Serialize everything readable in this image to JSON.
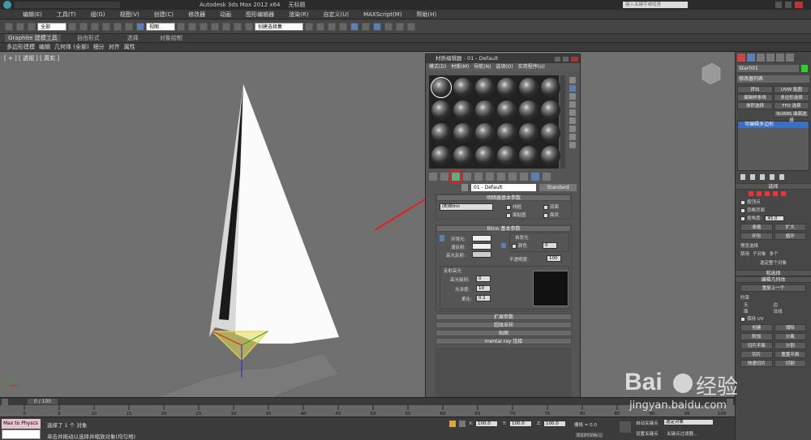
{
  "title_bar": {
    "app_title": "Autodesk 3ds Max  2012 x64",
    "file_name": "无标题",
    "search_placeholder": "键入关键字或短语"
  },
  "menu": [
    "编辑(E)",
    "工具(T)",
    "组(G)",
    "视图(V)",
    "创建(C)",
    "修改器",
    "动画",
    "图形编辑器",
    "渲染(R)",
    "自定义(U)",
    "MAXScript(M)",
    "帮助(H)"
  ],
  "toolbar": {
    "selection_filter": "全部",
    "ref_coord": "视图",
    "named_selection": "创建选择集"
  },
  "ribbon": {
    "tabs": [
      "Graphite 建模工具",
      "自由形式",
      "选择",
      "对象绘制"
    ],
    "sub_items": [
      "多边形建模",
      "编辑",
      "几何体 (全部)",
      "细分",
      "对齐",
      "属性"
    ]
  },
  "viewport": {
    "label": "[ + ] [ 透视 ] [ 真实 ]"
  },
  "material_editor": {
    "title": "材质编辑器 - 01 - Default",
    "menu": [
      "模式(D)",
      "材质(M)",
      "导航(N)",
      "选项(O)",
      "实用程序(U)"
    ],
    "material_name": "01 - Default",
    "material_type": "Standard",
    "shader_rollout": {
      "title": "明暗器基本参数",
      "shader": "(B)Blinn",
      "options": [
        "线框",
        "双面",
        "面贴图",
        "面状"
      ]
    },
    "blinn_rollout": {
      "title": "Blinn 基本参数",
      "self_illum_title": "自发光",
      "color_label": "颜色",
      "self_illum_value": "0",
      "ambient": "环境光:",
      "diffuse": "漫反射:",
      "specular": "高光反射:",
      "opacity_label": "不透明度:",
      "opacity_value": "100",
      "specular_highlights_title": "反射高光",
      "spec_level_label": "高光级别:",
      "spec_level": "0",
      "glossiness_label": "光泽度:",
      "glossiness": "10",
      "soften_label": "柔化:",
      "soften": "0.1"
    },
    "collapsed_rollouts": [
      "扩展参数",
      "超级采样",
      "贴图",
      "mental ray 连接"
    ]
  },
  "command_panel": {
    "object_name": "Star001",
    "modifier_list": "修改器列表",
    "buttons": [
      "挤出",
      "UVW 贴图",
      "编辑样条线",
      "多边形选择",
      "体积选择",
      "FFD 选择",
      "NURBS 曲面选择"
    ],
    "stack_item": "可编辑多边形",
    "selection_title": "选择",
    "by_vertex": "按顶点",
    "ignore_backfacing": "忽略背面",
    "by_angle": "按角度:",
    "angle_value": "45.0",
    "shrink": "收缩",
    "grow": "扩大",
    "ring": "环形",
    "loop": "循环",
    "preview_title": "预览选择",
    "preview_options": [
      "禁用",
      "子对象",
      "多个"
    ],
    "select_whole": "选定整个对象",
    "soft_selection": "软选择",
    "edit_geometry": "编辑几何体",
    "repeat_last": "重复上一个",
    "constraints": "约束",
    "constraint_options": [
      "无",
      "边",
      "面",
      "法线"
    ],
    "preserve_uvs": "保持 UV",
    "create": "创建",
    "collapse": "塌陷",
    "attach": "附加",
    "detach": "分离",
    "slice_plane": "切片平面",
    "split": "分割",
    "slice": "切片",
    "reset_plane": "重置平面",
    "quickslice": "快速切片",
    "cut": "切割"
  },
  "timeline": {
    "frame": "0 / 100",
    "ticks": [
      "0",
      "5",
      "10",
      "15",
      "20",
      "25",
      "30",
      "35",
      "40",
      "45",
      "50",
      "55",
      "60",
      "65",
      "70",
      "75",
      "80",
      "85",
      "90",
      "95",
      "100"
    ]
  },
  "status": {
    "maxscript": "Max to Physcs (",
    "selected": "选择了 1 个 对象",
    "prompt": "单击并拖动以选择并缩放对象(均匀地)",
    "x_label": "X:",
    "x_value": "100.0",
    "y_label": "Y:",
    "y_value": "100.0",
    "z_label": "Z:",
    "z_value": "100.0",
    "grid": "栅格 = 0.0",
    "add_time_tag": "添加时间标记",
    "auto_key": "自动关键点",
    "set_key": "设置关键点",
    "key_filter": "选定对象",
    "key_filters_btn": "关键点过滤器..."
  },
  "watermark": {
    "brand": "Bai",
    "brand_cn": "经验",
    "url": "jingyan.baidu.com"
  },
  "colors": {
    "highlight_red": "#e22020",
    "accent_blue": "#3a6fc4",
    "model_white": "#f2f2f2"
  }
}
